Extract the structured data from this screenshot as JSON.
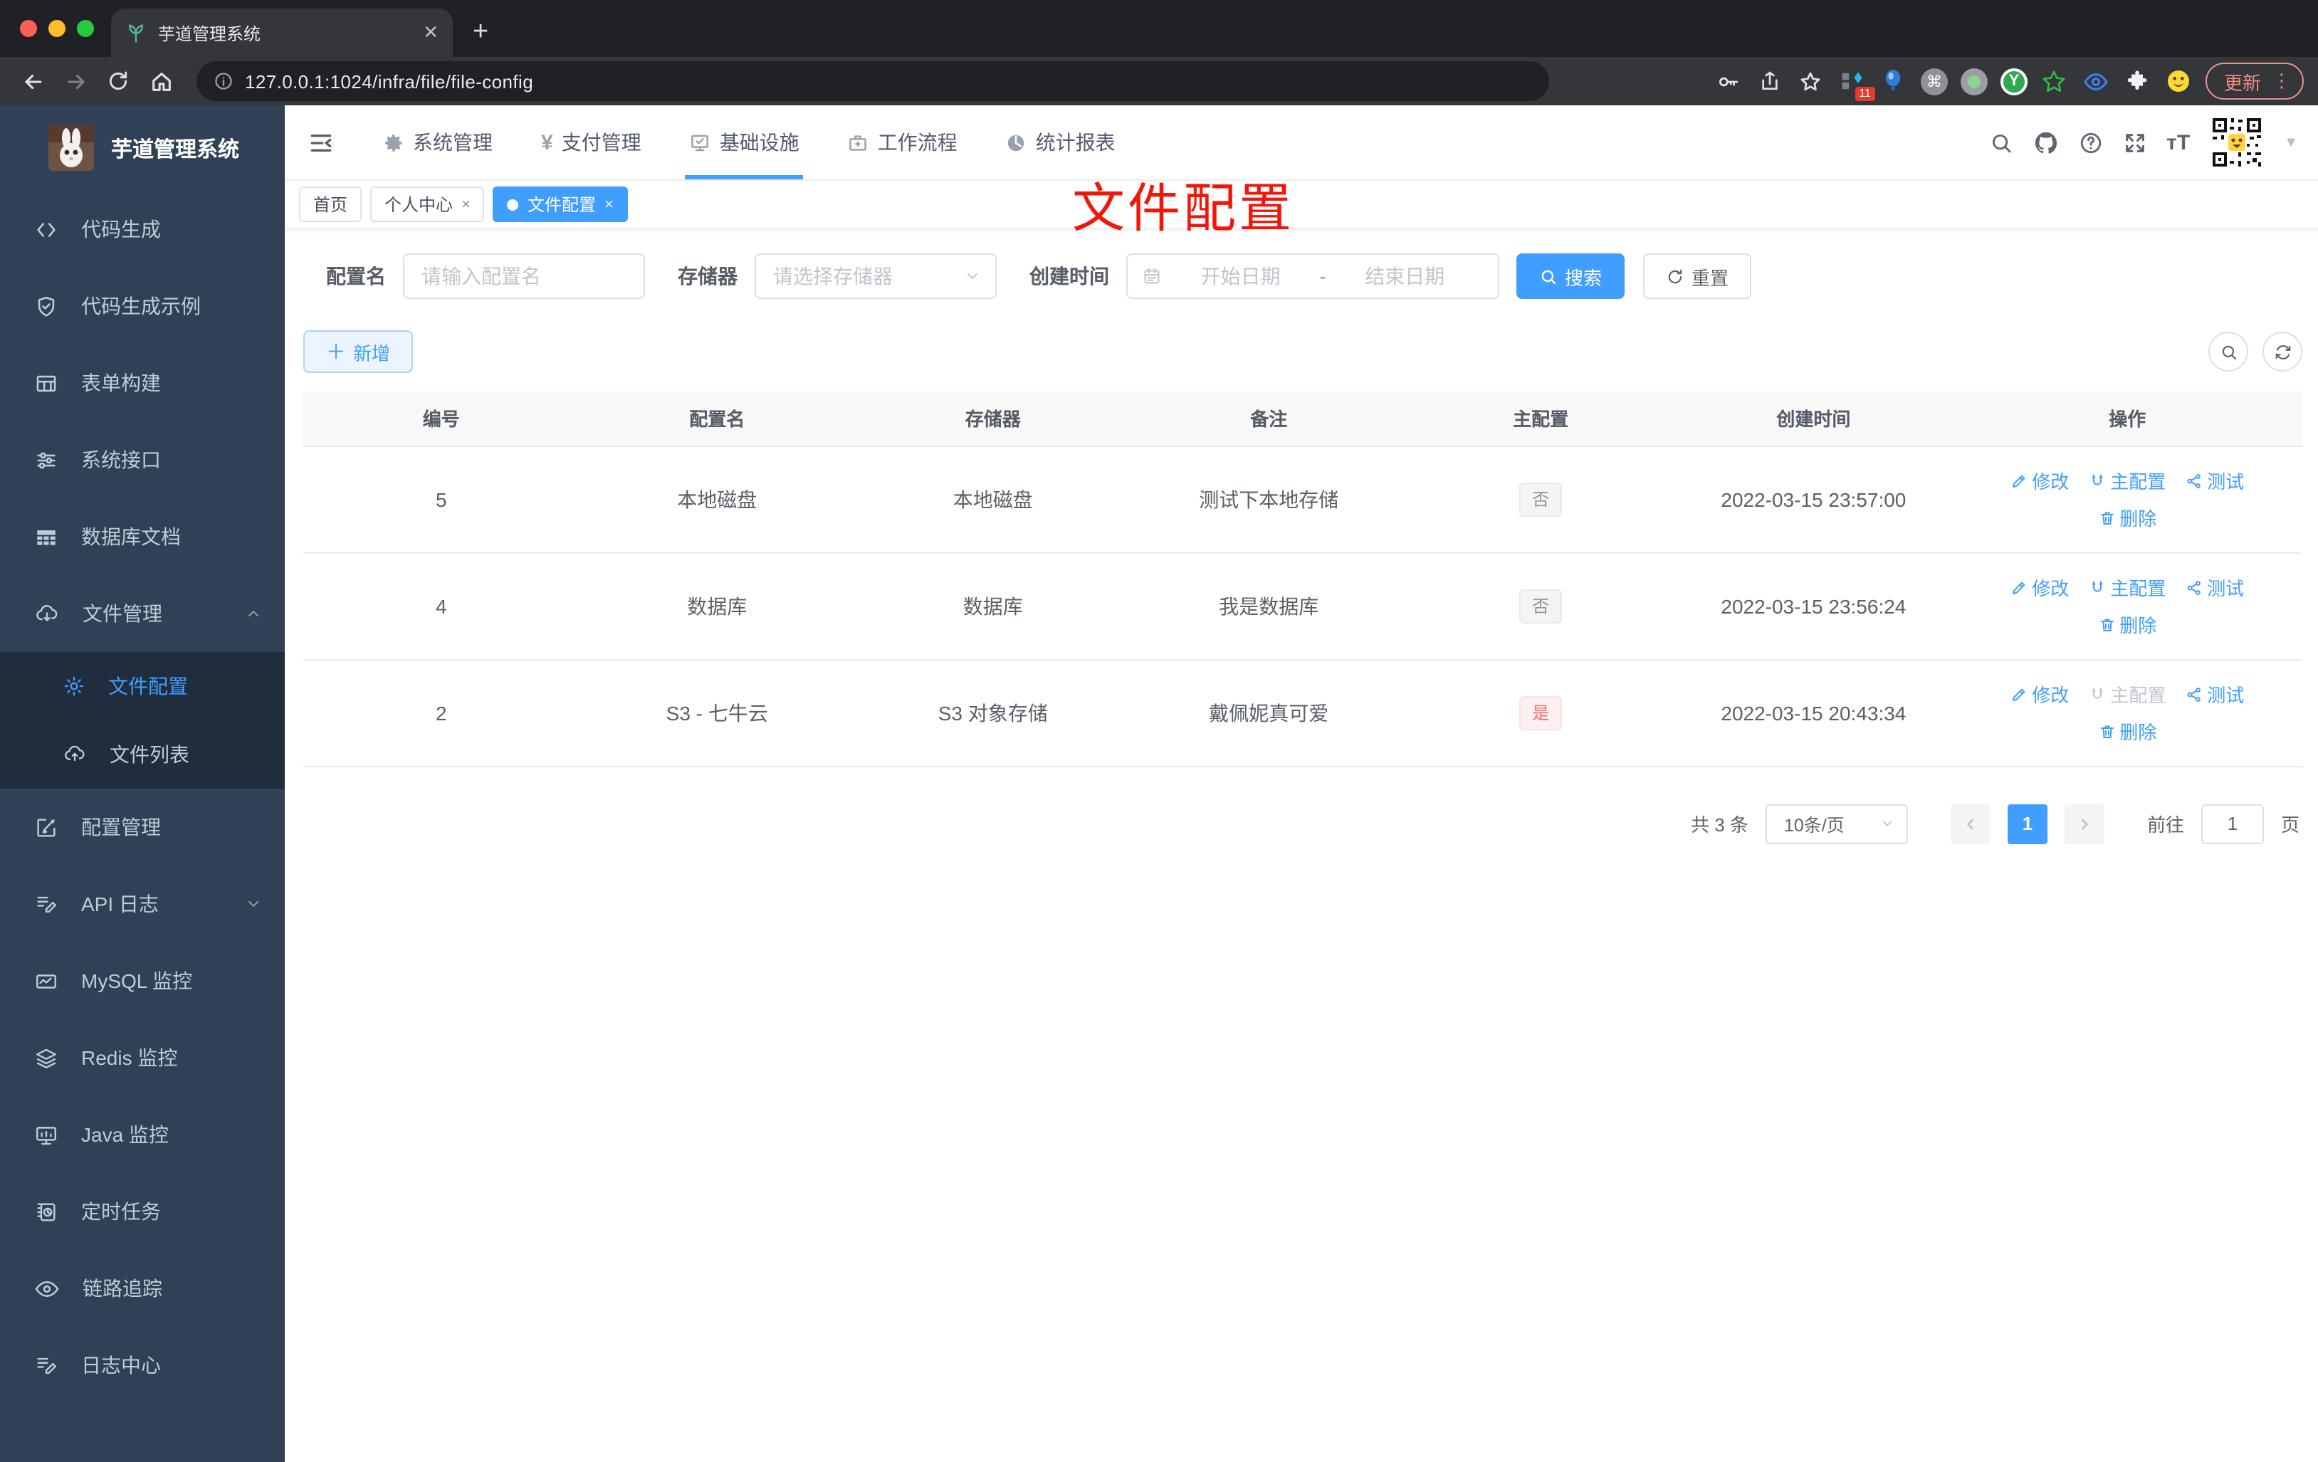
{
  "browser": {
    "tab_title": "芋道管理系统",
    "url": "127.0.0.1:1024/infra/file/file-config",
    "update_label": "更新",
    "extensions_badge": "11"
  },
  "sidebar": {
    "logo_title": "芋道管理系统",
    "items": [
      {
        "label": "代码生成",
        "icon": "code-icon"
      },
      {
        "label": "代码生成示例",
        "icon": "shield-check-icon"
      },
      {
        "label": "表单构建",
        "icon": "form-build-icon"
      },
      {
        "label": "系统接口",
        "icon": "sliders-icon"
      },
      {
        "label": "数据库文档",
        "icon": "table-grid-icon"
      },
      {
        "label": "文件管理",
        "icon": "cloud-download-icon",
        "expanded": true
      },
      {
        "label": "文件配置",
        "icon": "gear-icon",
        "active": true,
        "child": true
      },
      {
        "label": "文件列表",
        "icon": "cloud-upload-icon",
        "child": true
      },
      {
        "label": "配置管理",
        "icon": "edit-square-icon"
      },
      {
        "label": "API 日志",
        "icon": "doc-pen-icon",
        "collapsed": true
      },
      {
        "label": "MySQL 监控",
        "icon": "chart-icon"
      },
      {
        "label": "Redis 监控",
        "icon": "layers-icon"
      },
      {
        "label": "Java 监控",
        "icon": "monitor-icon"
      },
      {
        "label": "定时任务",
        "icon": "schedule-icon"
      },
      {
        "label": "链路追踪",
        "icon": "eye-icon"
      },
      {
        "label": "日志中心",
        "icon": "log-center-icon"
      }
    ]
  },
  "topnav": {
    "items": [
      {
        "label": "系统管理",
        "icon": "gear-icon"
      },
      {
        "label": "支付管理",
        "icon": "yen-icon"
      },
      {
        "label": "基础设施",
        "icon": "infra-icon",
        "active": true
      },
      {
        "label": "工作流程",
        "icon": "briefcase-icon"
      },
      {
        "label": "统计报表",
        "icon": "report-icon"
      }
    ]
  },
  "tabsbar": {
    "tabs": [
      {
        "label": "首页",
        "closable": false,
        "active": false
      },
      {
        "label": "个人中心",
        "closable": true,
        "active": false
      },
      {
        "label": "文件配置",
        "closable": true,
        "active": true
      }
    ],
    "close_glyph": "×"
  },
  "annotation": {
    "text": "文件配置",
    "color": "#f2150a"
  },
  "filters": {
    "name_label": "配置名",
    "name_placeholder": "请输入配置名",
    "storage_label": "存储器",
    "storage_placeholder": "请选择存储器",
    "time_label": "创建时间",
    "start_placeholder": "开始日期",
    "separator": "-",
    "end_placeholder": "结束日期",
    "search_label": "搜索",
    "reset_label": "重置"
  },
  "actions_bar": {
    "add_label": "新增"
  },
  "table": {
    "headers": [
      "编号",
      "配置名",
      "存储器",
      "备注",
      "主配置",
      "创建时间",
      "操作"
    ],
    "row_actions": {
      "edit": "修改",
      "master": "主配置",
      "test": "测试",
      "delete": "删除"
    },
    "rows": [
      {
        "id": "5",
        "name": "本地磁盘",
        "storage": "本地磁盘",
        "remark": "测试下本地存储",
        "master": "否",
        "created": "2022-03-15 23:57:00"
      },
      {
        "id": "4",
        "name": "数据库",
        "storage": "数据库",
        "remark": "我是数据库",
        "master": "否",
        "created": "2022-03-15 23:56:24"
      },
      {
        "id": "2",
        "name": "S3 - 七牛云",
        "storage": "S3 对象存储",
        "remark": "戴佩妮真可爱",
        "master": "是",
        "created": "2022-03-15 20:43:34"
      }
    ]
  },
  "pagination": {
    "total": "共 3 条",
    "page_size": "10条/页",
    "current_page": "1",
    "goto_label": "前往",
    "goto_value": "1",
    "unit_label": "页"
  },
  "colors": {
    "primary": "#409eff",
    "danger": "#f56c6c",
    "sidebar_bg": "#304156",
    "submenu_bg": "#1f2d3d",
    "annotation_red": "#f2150a",
    "chrome_bg": "#35363a"
  }
}
